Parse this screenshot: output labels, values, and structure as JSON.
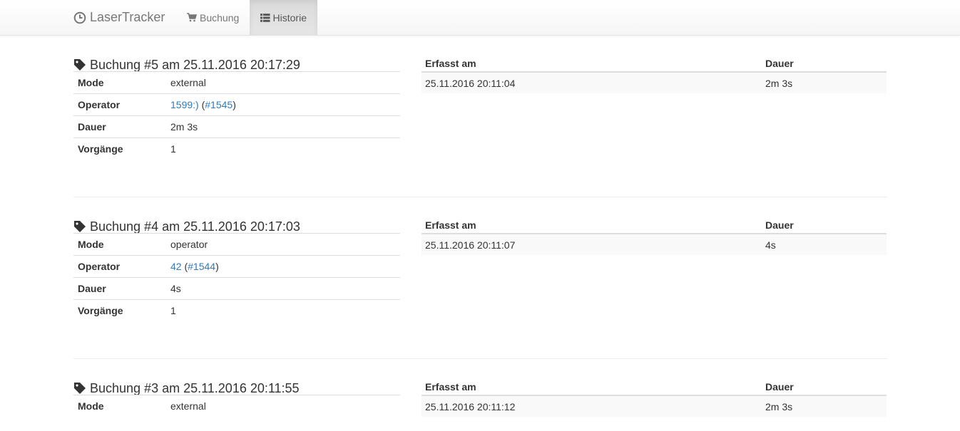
{
  "app": {
    "brand": "LaserTracker",
    "nav": [
      {
        "label": "Buchung",
        "icon": "cart-icon",
        "active": false
      },
      {
        "label": "Historie",
        "icon": "list-icon",
        "active": true
      }
    ]
  },
  "bookings": [
    {
      "title": "Buchung #5 am 25.11.2016 20:17:29",
      "details": {
        "mode_label": "Mode",
        "mode": "external",
        "operator_label": "Operator",
        "operator_name": "1599:)",
        "operator_open": " (",
        "operator_id": "#1545",
        "operator_close": ")",
        "duration_label": "Dauer",
        "duration": "2m 3s",
        "count_label": "Vorgänge",
        "count": "1"
      },
      "entries": {
        "col_recorded": "Erfasst am",
        "col_duration": "Dauer",
        "rows": [
          {
            "recorded": "25.11.2016 20:11:04",
            "duration": "2m 3s"
          }
        ]
      }
    },
    {
      "title": "Buchung #4 am 25.11.2016 20:17:03",
      "details": {
        "mode_label": "Mode",
        "mode": "operator",
        "operator_label": "Operator",
        "operator_name": "42",
        "operator_open": " (",
        "operator_id": "#1544",
        "operator_close": ")",
        "duration_label": "Dauer",
        "duration": "4s",
        "count_label": "Vorgänge",
        "count": "1"
      },
      "entries": {
        "col_recorded": "Erfasst am",
        "col_duration": "Dauer",
        "rows": [
          {
            "recorded": "25.11.2016 20:11:07",
            "duration": "4s"
          }
        ]
      }
    },
    {
      "title": "Buchung #3 am 25.11.2016 20:11:55",
      "details": {
        "mode_label": "Mode",
        "mode": "external"
      },
      "entries": {
        "col_recorded": "Erfasst am",
        "col_duration": "Dauer",
        "rows": [
          {
            "recorded": "25.11.2016 20:11:12",
            "duration": "2m 3s"
          }
        ]
      }
    }
  ],
  "colors": {
    "link": "#337ab7",
    "text": "#333333",
    "nav_text": "#777777"
  }
}
